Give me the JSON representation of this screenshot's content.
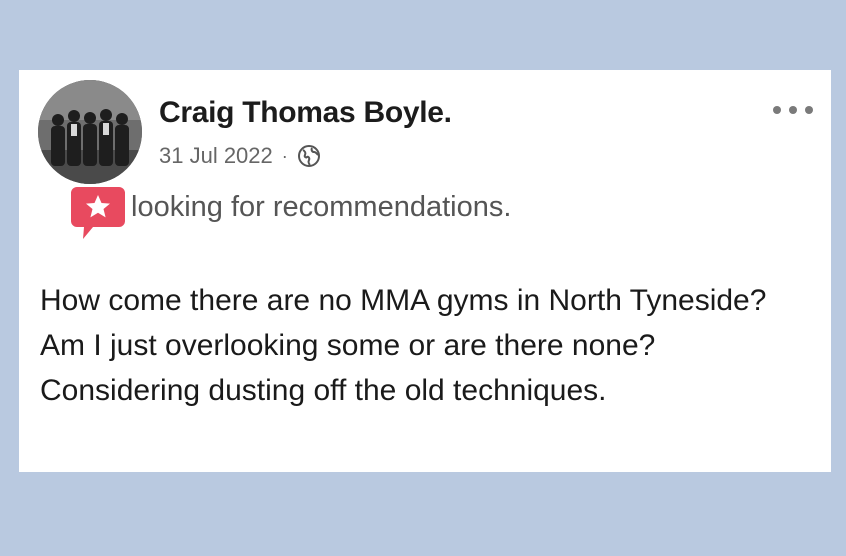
{
  "post": {
    "author_name": "Craig Thomas Boyle.",
    "date": "31 Jul 2022",
    "separator": "·",
    "privacy_icon": "globe-icon",
    "menu_icon": "more-options-icon",
    "tag": {
      "icon": "star-speech-bubble-icon",
      "label": "looking for recommendations."
    },
    "body": "How come there are no MMA gyms in North Tyneside? Am I just overlooking some or are there none? Considering dusting off the old techniques."
  },
  "colors": {
    "background": "#b9c9e0",
    "card": "#ffffff",
    "tag_accent": "#e84a5f",
    "name_text": "#1c1c1c",
    "meta_text": "#666666"
  }
}
